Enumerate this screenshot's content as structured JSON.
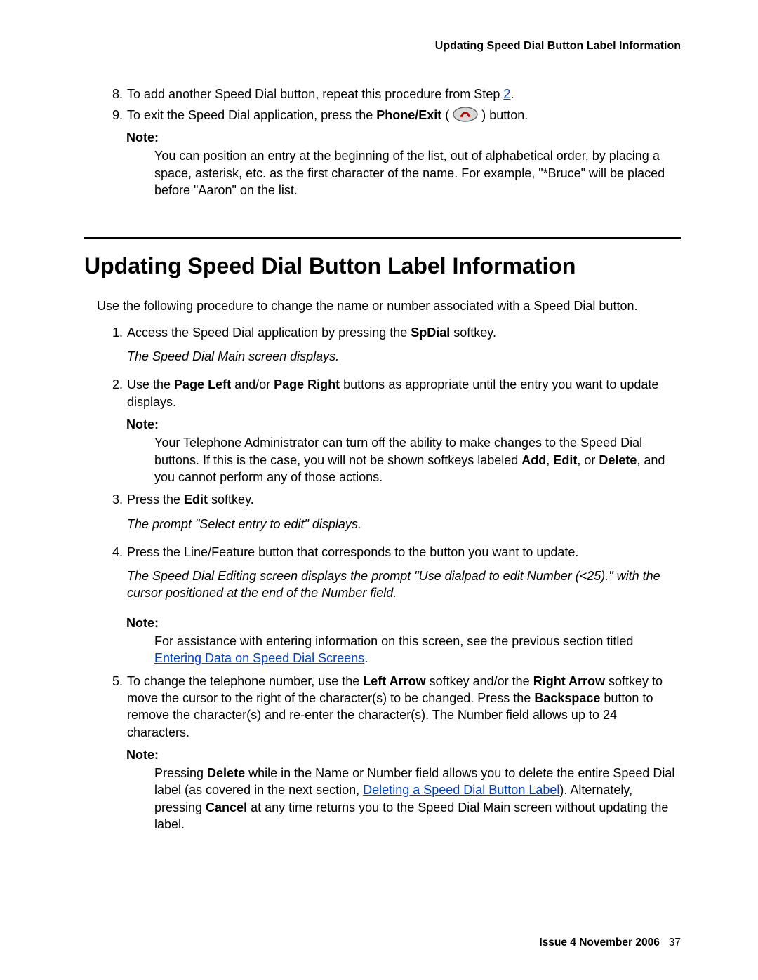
{
  "running_head": "Updating Speed Dial Button Label Information",
  "top_steps": {
    "s8": {
      "num": "8.",
      "pre": "To add another Speed Dial button, repeat this procedure from Step ",
      "link": "2",
      "post": "."
    },
    "s9": {
      "num": "9.",
      "pre": "To exit the Speed Dial application, press the ",
      "bold": "Phone/Exit",
      "mid": " (",
      "mid2": ") button."
    },
    "note": {
      "label": "Note:",
      "body": "You can position an entry at the beginning of the list, out of alphabetical order, by placing a space, asterisk, etc. as the first character of the name. For example, \"*Bruce\" will be placed before \"Aaron\" on the list."
    }
  },
  "section_title": "Updating Speed Dial Button Label Information",
  "intro": "Use the following procedure to change the name or number associated with a Speed Dial button.",
  "steps": {
    "s1": {
      "num": "1.",
      "a": "Access the Speed Dial application by pressing the ",
      "b1": "SpDial",
      "c": " softkey.",
      "result": "The Speed Dial Main screen displays."
    },
    "s2": {
      "num": "2.",
      "a": "Use the ",
      "b1": "Page Left",
      "mid": " and/or ",
      "b2": "Page Right",
      "c": " buttons as appropriate until the entry you want to update displays.",
      "note_label": "Note:",
      "note_a": "Your Telephone Administrator can turn off the ability to make changes to the Speed Dial buttons. If this is the case, you will not be shown softkeys labeled ",
      "nb1": "Add",
      "sep1": ", ",
      "nb2": "Edit",
      "sep2": ", or ",
      "nb3": "Delete",
      "note_c": ", and you cannot perform any of those actions."
    },
    "s3": {
      "num": "3.",
      "a": "Press the ",
      "b1": "Edit",
      "c": " softkey.",
      "result": "The prompt \"Select entry to edit\" displays."
    },
    "s4": {
      "num": "4.",
      "a": "Press the Line/Feature button that corresponds to the button you want to update.",
      "result": "The Speed Dial Editing screen displays the prompt \"Use dialpad to edit Number (<25).\" with the cursor positioned at the end of the Number field.",
      "note_label": "Note:",
      "note_a": "For assistance with entering information on this screen, see the previous section titled ",
      "link": "Entering Data on Speed Dial Screens",
      "note_c": "."
    },
    "s5": {
      "num": "5.",
      "a": "To change the telephone number, use the ",
      "b1": "Left Arrow",
      "mid": " softkey and/or the ",
      "b2": "Right Arrow",
      "c": " softkey to move the cursor to the right of the character(s) to be changed. Press the ",
      "b3": "Backspace",
      "d": " button to remove the character(s) and re-enter the character(s). The Number field allows up to 24 characters.",
      "note_label": "Note:",
      "note_a": "Pressing ",
      "nb1": "Delete",
      "note_b": " while in the Name or Number field allows you to delete the entire Speed Dial label (as covered in the next section, ",
      "link": "Deleting a Speed Dial Button Label",
      "note_c": "). Alternately, pressing ",
      "nb2": "Cancel",
      "note_d": " at any time returns you to the Speed Dial Main screen without updating the label."
    }
  },
  "footer": {
    "issue": "Issue 4   November 2006",
    "page": "37"
  }
}
